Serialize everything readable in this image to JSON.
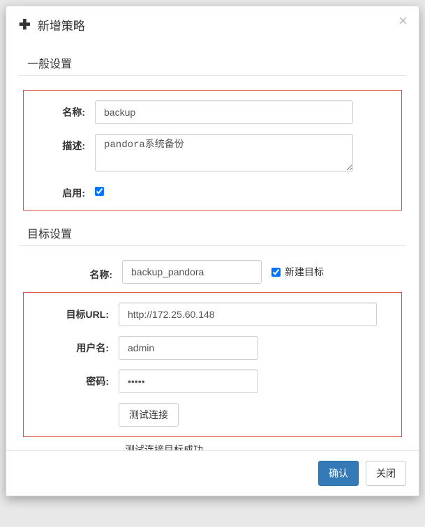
{
  "modal": {
    "title": "新增策略",
    "close_label": "✕"
  },
  "general": {
    "section_title": "一般设置",
    "name_label": "名称:",
    "name_value": "backup",
    "desc_label": "描述:",
    "desc_value": "pandora系统备份",
    "enable_label": "启用:",
    "enable_checked": true
  },
  "target": {
    "section_title": "目标设置",
    "name_label": "名称:",
    "name_value": "backup_pandora",
    "new_target_label": "新建目标",
    "new_target_checked": true,
    "url_label": "目标URL:",
    "url_value": "http://172.25.60.148",
    "user_label": "用户名:",
    "user_value": "admin",
    "pwd_label": "密码:",
    "pwd_value": "•••••",
    "test_btn": "测试连接",
    "test_result": "测试连接目标成功。"
  },
  "footer": {
    "ok": "确认",
    "close": "关闭"
  }
}
